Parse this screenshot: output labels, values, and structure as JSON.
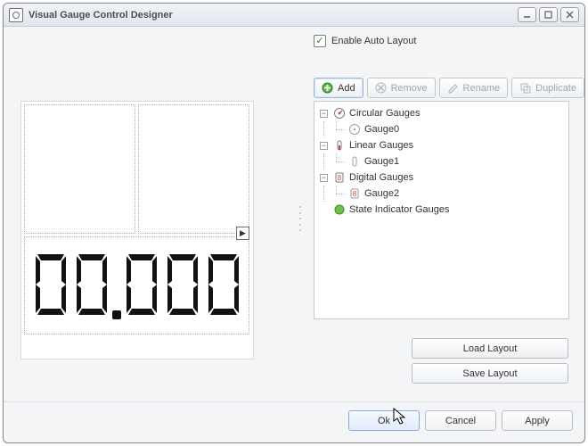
{
  "window": {
    "title": "Visual Gauge Control Designer"
  },
  "enableAuto": {
    "label": "Enable Auto Layout",
    "checked": true
  },
  "toolbar": {
    "add": "Add",
    "remove": "Remove",
    "rename": "Rename",
    "duplicate": "Duplicate"
  },
  "tree": {
    "circular": {
      "label": "Circular Gauges",
      "child": "Gauge0"
    },
    "linear": {
      "label": "Linear Gauges",
      "child": "Gauge1"
    },
    "digital": {
      "label": "Digital Gauges",
      "child": "Gauge2"
    },
    "state": {
      "label": "State Indicator Gauges"
    }
  },
  "sideButtons": {
    "load": "Load Layout",
    "save": "Save Layout"
  },
  "bottom": {
    "ok": "Ok",
    "cancel": "Cancel",
    "apply": "Apply"
  },
  "digitalDisplay": {
    "value": "00.000"
  }
}
